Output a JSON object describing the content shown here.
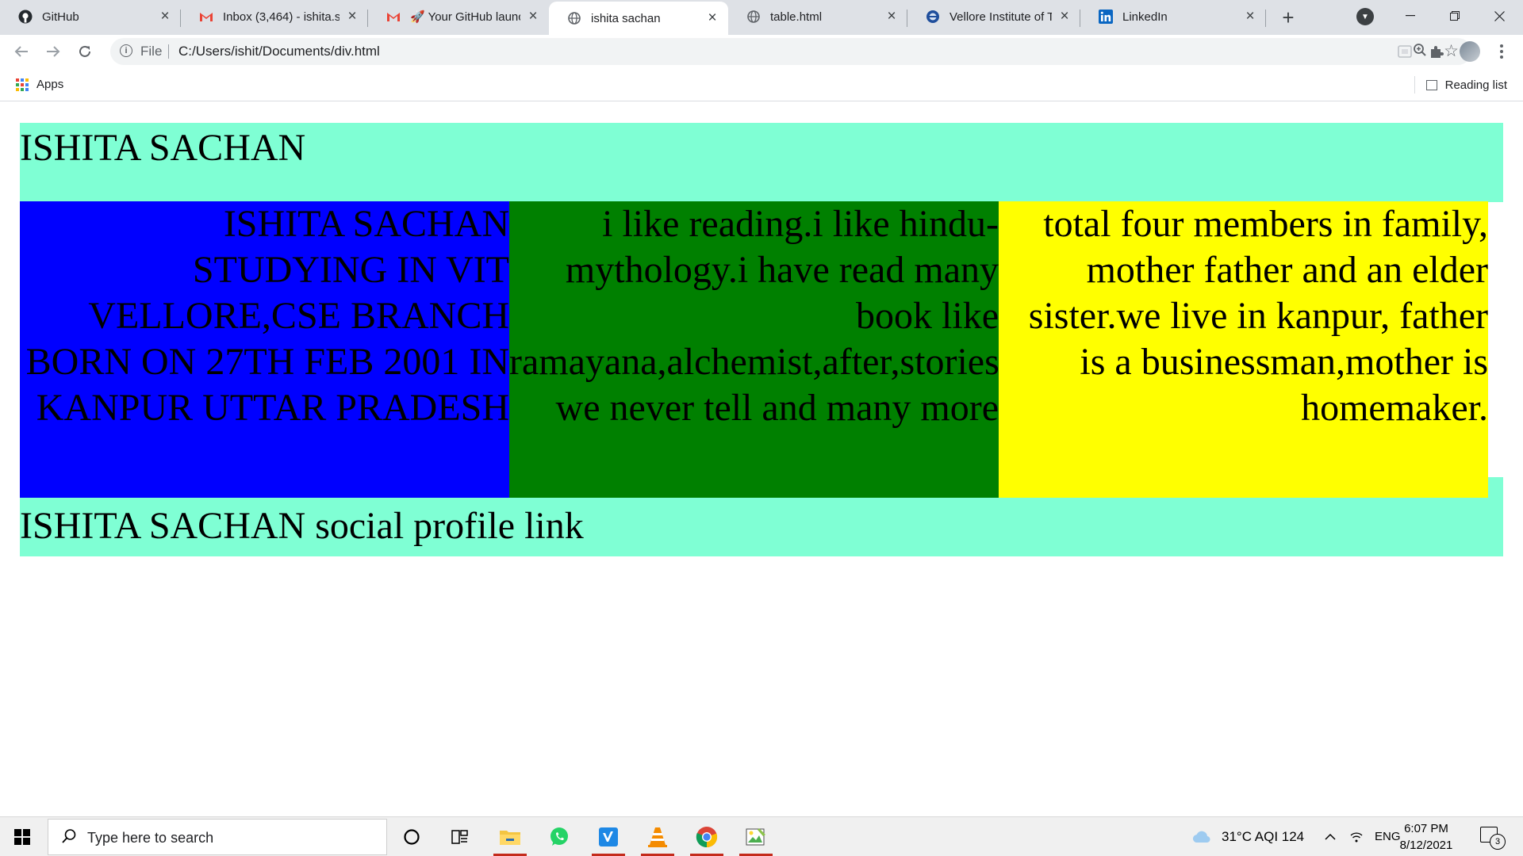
{
  "tabs": [
    {
      "label": "GitHub",
      "icon": "github-icon",
      "active": false
    },
    {
      "label": "Inbox (3,464) - ishita.s",
      "icon": "gmail-icon",
      "active": false
    },
    {
      "label": "🚀 Your GitHub launc",
      "icon": "gmail-icon",
      "active": false
    },
    {
      "label": "ishita sachan",
      "icon": "globe-icon",
      "active": true
    },
    {
      "label": "table.html",
      "icon": "globe-icon",
      "active": false
    },
    {
      "label": "Vellore Institute of Tec",
      "icon": "vit-logo-icon",
      "active": false
    },
    {
      "label": "LinkedIn",
      "icon": "linkedin-icon",
      "active": false
    }
  ],
  "address_bar": {
    "scheme": "File",
    "url": "C:/Users/ishit/Documents/div.html"
  },
  "bookmarks": {
    "apps_label": "Apps",
    "reading_list_label": "Reading list"
  },
  "page": {
    "header_text": "ISHITA SACHAN",
    "column_1_text": "ISHITA SACHAN STUDYING IN VIT VELLORE,CSE BRANCH BORN ON 27TH FEB 2001 IN KANPUR UTTAR PRADESH",
    "column_2_text": "i like reading.i like hindu-mythology.i have read many book like ramayana,alchemist,after,stories we never tell and many more",
    "column_3_text": "total four members in family, mother father and an elder sister.we live in kanpur, father is a businessman,mother is homemaker.",
    "footer_text": "ISHITA SACHAN social profile link",
    "colors": {
      "header_bg": "#7fffd4",
      "column_1_bg": "#0000ff",
      "column_2_bg": "#008000",
      "column_3_bg": "#ffff00",
      "footer_bg": "#7fffd4"
    }
  },
  "taskbar": {
    "search_placeholder": "Type here to search",
    "weather": "31°C  AQI 124",
    "language": "ENG",
    "time": "6:07 PM",
    "date": "8/12/2021",
    "notification_count": "3"
  }
}
